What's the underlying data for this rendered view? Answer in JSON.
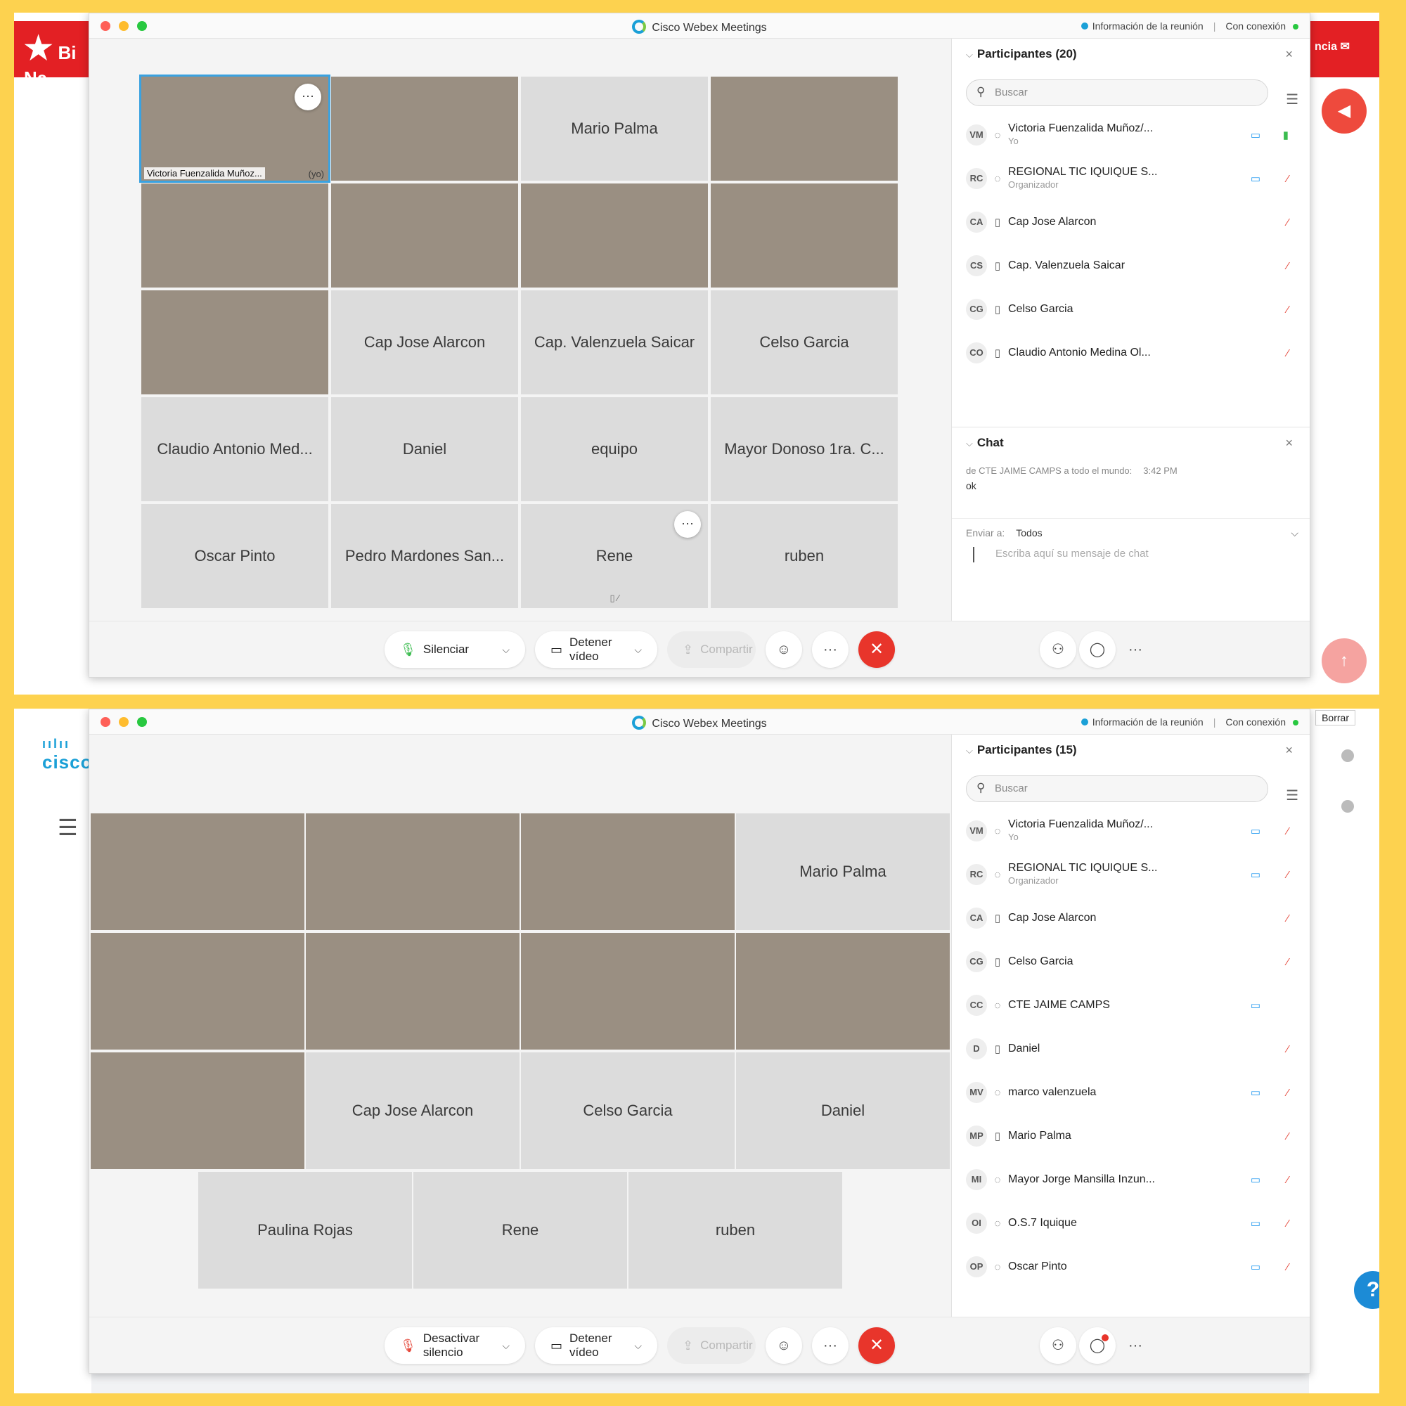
{
  "window": {
    "title": "Cisco Webex Meetings",
    "info": "Información de la reunión",
    "connection": "Con conexión"
  },
  "top": {
    "background": {
      "brand_text": "Bi Na",
      "right_text": "ncia"
    },
    "tiles": [
      {
        "name": "Victoria Fuenzalida Muñoz...",
        "suffix": "(yo)",
        "video": true,
        "self": true,
        "more": "···"
      },
      {
        "name": "",
        "video": true
      },
      {
        "name": "Mario Palma",
        "video": false
      },
      {
        "name": "",
        "video": true
      },
      {
        "name": "",
        "video": true
      },
      {
        "name": "",
        "video": true
      },
      {
        "name": "",
        "video": true
      },
      {
        "name": "",
        "video": true
      },
      {
        "name": "",
        "video": true
      },
      {
        "name": "Cap Jose Alarcon",
        "video": false
      },
      {
        "name": "Cap. Valenzuela Saicar",
        "video": false
      },
      {
        "name": "Celso Garcia",
        "video": false
      },
      {
        "name": "Claudio Antonio Med...",
        "video": false
      },
      {
        "name": "Daniel",
        "video": false
      },
      {
        "name": "equipo",
        "video": false
      },
      {
        "name": "Mayor Donoso 1ra. C...",
        "video": false
      },
      {
        "name": "Oscar Pinto",
        "video": false
      },
      {
        "name": "Pedro Mardones San...",
        "video": false
      },
      {
        "name": "Rene",
        "video": false,
        "more": "···"
      },
      {
        "name": "ruben",
        "video": false
      }
    ],
    "participants_title": "Participantes (20)",
    "search_placeholder": "Buscar",
    "participants": [
      {
        "initials": "VM",
        "name": "Victoria Fuenzalida Muñoz/...",
        "role": "Yo",
        "cam": true,
        "mic_on": true
      },
      {
        "initials": "RC",
        "name": "REGIONAL TIC IQUIQUE S...",
        "role": "Organizador",
        "cam": true,
        "mic_on": false
      },
      {
        "initials": "CA",
        "name": "Cap Jose Alarcon",
        "role": "",
        "cam": false,
        "mic_on": false
      },
      {
        "initials": "CS",
        "name": "Cap. Valenzuela Saicar",
        "role": "",
        "cam": false,
        "mic_on": false
      },
      {
        "initials": "CG",
        "name": "Celso Garcia",
        "role": "",
        "cam": false,
        "mic_on": false
      },
      {
        "initials": "CO",
        "name": "Claudio Antonio Medina Ol...",
        "role": "",
        "cam": false,
        "mic_on": false
      }
    ],
    "chat": {
      "title": "Chat",
      "from": "de CTE JAIME CAMPS a todo el mundo:",
      "time": "3:42 PM",
      "message": "ok",
      "send_to_label": "Enviar a:",
      "send_to_value": "Todos",
      "input_placeholder": "Escriba aquí su mensaje de chat"
    },
    "controls": {
      "mute": "Silenciar",
      "video": "Detener vídeo",
      "share": "Compartir"
    }
  },
  "bottom": {
    "background": {
      "logo": "cisco",
      "clear_button": "Borrar",
      "help": "?"
    },
    "tiles": [
      {
        "name": "",
        "video": true
      },
      {
        "name": "",
        "video": true
      },
      {
        "name": "",
        "video": true
      },
      {
        "name": "Mario Palma",
        "video": false
      },
      {
        "name": "",
        "video": true
      },
      {
        "name": "",
        "video": true
      },
      {
        "name": "",
        "video": true
      },
      {
        "name": "",
        "video": true
      },
      {
        "name": "",
        "video": true
      },
      {
        "name": "Cap Jose Alarcon",
        "video": false
      },
      {
        "name": "Celso Garcia",
        "video": false
      },
      {
        "name": "Daniel",
        "video": false
      },
      {
        "name": "Paulina Rojas",
        "video": false
      },
      {
        "name": "Rene",
        "video": false
      },
      {
        "name": "ruben",
        "video": false
      }
    ],
    "participants_title": "Participantes (15)",
    "search_placeholder": "Buscar",
    "participants": [
      {
        "initials": "VM",
        "name": "Victoria Fuenzalida Muñoz/...",
        "role": "Yo",
        "cam": true,
        "mic_on": false
      },
      {
        "initials": "RC",
        "name": "REGIONAL TIC IQUIQUE S...",
        "role": "Organizador",
        "cam": true,
        "mic_on": false
      },
      {
        "initials": "CA",
        "name": "Cap Jose Alarcon",
        "role": "",
        "cam": false,
        "mic_on": false
      },
      {
        "initials": "CG",
        "name": "Celso Garcia",
        "role": "",
        "cam": false,
        "mic_on": false
      },
      {
        "initials": "CC",
        "name": "CTE JAIME CAMPS",
        "role": "",
        "cam": true,
        "mic_on": null
      },
      {
        "initials": "D",
        "name": "Daniel",
        "role": "",
        "cam": false,
        "mic_on": false
      },
      {
        "initials": "MV",
        "name": "marco valenzuela",
        "role": "",
        "cam": true,
        "mic_on": false
      },
      {
        "initials": "MP",
        "name": "Mario Palma",
        "role": "",
        "cam": false,
        "mic_on": false
      },
      {
        "initials": "MI",
        "name": "Mayor Jorge Mansilla Inzun...",
        "role": "",
        "cam": true,
        "mic_on": false
      },
      {
        "initials": "OI",
        "name": "O.S.7 Iquique",
        "role": "",
        "cam": true,
        "mic_on": false
      },
      {
        "initials": "OP",
        "name": "Oscar Pinto",
        "role": "",
        "cam": true,
        "mic_on": false
      }
    ],
    "controls": {
      "mute": "Desactivar silencio",
      "video": "Detener vídeo",
      "share": "Compartir"
    }
  },
  "icons": {
    "search": "search-icon",
    "sort": "sort-icon",
    "close": "close-icon",
    "mic": "mic-icon",
    "camera": "camera-icon",
    "share": "share-icon",
    "reactions": "reactions-icon",
    "more": "more-icon",
    "end": "end-call-icon",
    "participants": "participants-icon",
    "chat": "chat-icon"
  },
  "colors": {
    "frame": "#fdd24f",
    "end_call": "#e8352b",
    "webex_blue": "#1ba0d7",
    "mic_off": "#e5483b",
    "mic_on": "#3bbc4f"
  }
}
